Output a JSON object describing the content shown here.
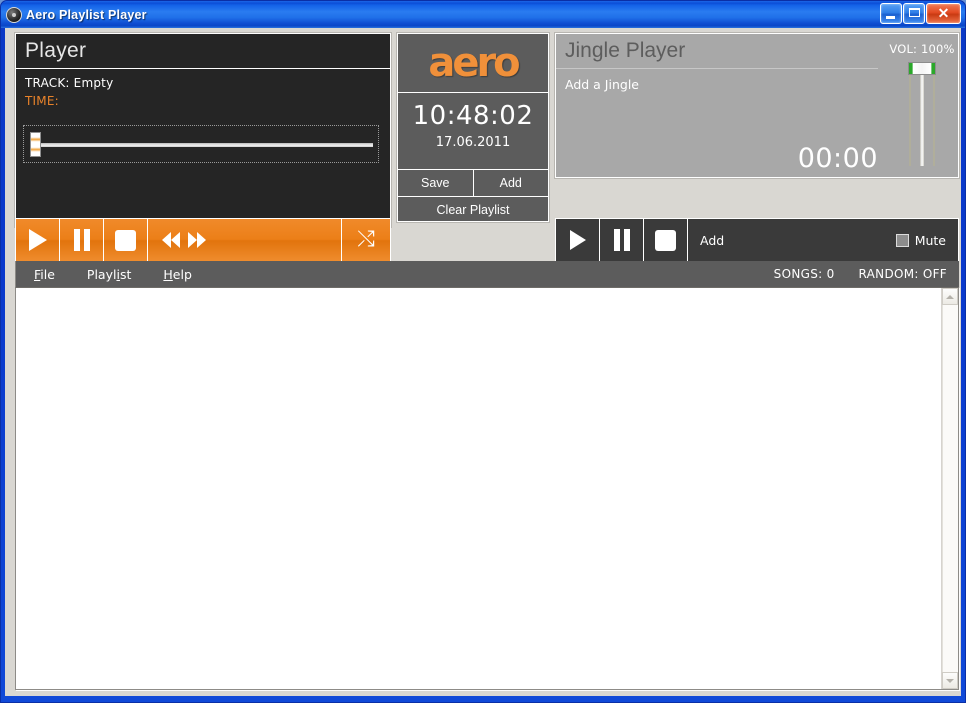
{
  "window": {
    "title": "Aero Playlist Player",
    "icon": "disc-icon",
    "buttons": {
      "minimize": "minimize-icon",
      "maximize": "maximize-icon",
      "close": "✕"
    }
  },
  "player": {
    "header": "Player",
    "track_label": "TRACK: Empty",
    "time_label": "TIME:",
    "seek_value": 0,
    "transport": {
      "play": "play-icon",
      "pause": "pause-icon",
      "stop": "stop-icon",
      "previous": "previous-icon",
      "next": "next-icon",
      "shuffle": "⤭"
    }
  },
  "center": {
    "logo": "aero",
    "clock_time": "10:48:02",
    "clock_date": "17.06.2011",
    "save_label": "Save",
    "add_label": "Add",
    "clear_label": "Clear Playlist"
  },
  "jingle": {
    "header": "Jingle Player",
    "name": "Add a Jingle",
    "time": "00:00",
    "volume_label": "VOL: 100%",
    "volume_value": 100,
    "transport": {
      "play": "play-icon",
      "pause": "pause-icon",
      "stop": "stop-icon",
      "add_label": "Add",
      "mute_label": "Mute",
      "mute_checked": false
    }
  },
  "menu": {
    "items": [
      {
        "label": "File",
        "accel_index": 0
      },
      {
        "label": "Playlist",
        "accel_index": 5
      },
      {
        "label": "Help",
        "accel_index": 0
      }
    ],
    "status": {
      "songs": "SONGS: 0",
      "random": "RANDOM: OFF"
    }
  },
  "playlist": {
    "rows": []
  },
  "colors": {
    "accent_orange": "#ec7f18",
    "panel_dark": "#252525",
    "panel_gray": "#5c5c5c",
    "jingle_gray": "#a8a8a8",
    "title_blue": "#0b39c6",
    "volume_green": "#2aa82a"
  }
}
